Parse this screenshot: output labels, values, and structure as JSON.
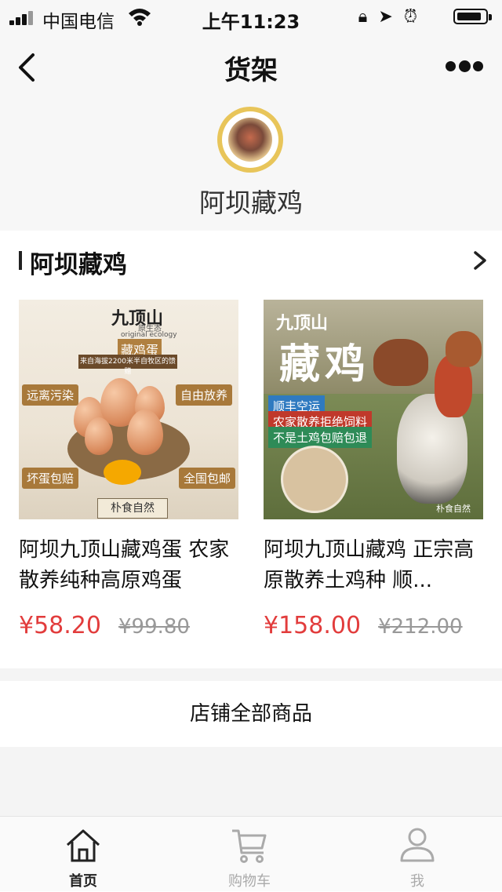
{
  "status_bar": {
    "carrier": "中国电信",
    "time": "上午11:23",
    "battery_level": 0.9
  },
  "nav": {
    "title": "货架"
  },
  "shop": {
    "name": "阿坝藏鸡"
  },
  "section": {
    "title": "阿坝藏鸡"
  },
  "products": [
    {
      "title": "阿坝九顶山藏鸡蛋 农家散养纯种高原鸡蛋",
      "price": "¥58.20",
      "original_price": "¥99.80",
      "image_text": {
        "brand": "九顶山",
        "eco": "原生态",
        "ecology_en": "original ecology",
        "product": "藏鸡蛋",
        "banner": "来自海拔2200米半自牧区的馈赠",
        "tag_tl": "远离污染",
        "tag_tr": "自由放养",
        "tag_bl": "坏蛋包赔",
        "tag_br": "全国包邮",
        "stamp": "朴食自然"
      }
    },
    {
      "title": "阿坝九顶山藏鸡 正宗高原散养土鸡种 顺...",
      "price": "¥158.00",
      "original_price": "¥212.00",
      "image_text": {
        "brand": "九顶山",
        "product": "藏鸡",
        "tag1": "顺丰空运",
        "tag2": "农家散养拒绝饲料",
        "tag3": "不是土鸡包赔包退",
        "watermark": "朴食自然"
      }
    }
  ],
  "all_products_label": "店铺全部商品",
  "tabs": [
    {
      "label": "首页",
      "icon": "home-icon",
      "active": true
    },
    {
      "label": "购物车",
      "icon": "cart-icon",
      "active": false
    },
    {
      "label": "我",
      "icon": "user-icon",
      "active": false
    }
  ],
  "colors": {
    "price": "#e23c3c",
    "original_price": "#999999",
    "background": "#f7f7f7"
  }
}
